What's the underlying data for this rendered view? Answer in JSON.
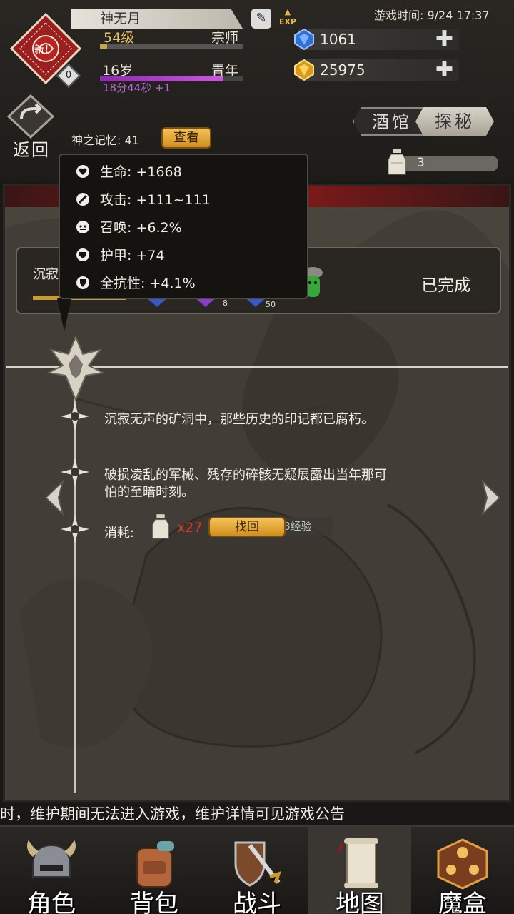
{
  "header": {
    "player_name": "神无月",
    "level_text": "54级",
    "title_text": "宗师",
    "level_progress": 0.05,
    "age_text": "16岁",
    "stage_text": "青年",
    "age_progress": 0.86,
    "timer_text": "18分44秒 +1",
    "avatar_badge": "新！",
    "level_badge": "0",
    "game_time": "游戏时间: 9/24 17:37",
    "exp_label": "EXP",
    "diamonds": "1061",
    "gold": "25975",
    "back_label": "返回",
    "memory_label": "神之记忆: 41",
    "view_button": "查看",
    "tab_tavern": "酒馆",
    "tab_explore": "探秘",
    "jar_count": "3"
  },
  "tooltip": {
    "stats": [
      {
        "icon": "heart-icon",
        "text": "生命: +1668"
      },
      {
        "icon": "sword-icon",
        "text": "攻击: +111~111"
      },
      {
        "icon": "summon-icon",
        "text": "召唤: +6.2%"
      },
      {
        "icon": "armor-icon",
        "text": "护甲: +74"
      },
      {
        "icon": "resist-icon",
        "text": "全抗性: +4.1%"
      }
    ]
  },
  "quest": {
    "name": "沉寂",
    "status": "已完成",
    "badge_values": [
      "8",
      "50"
    ]
  },
  "story": {
    "line1": "沉寂无声的矿洞中，那些历史的印记都已腐朽。",
    "line2a": "破损凌乱的军械、残存的碎骸无疑展露出当年那可",
    "line2b": "怕的至暗时刻。",
    "cost_label": "消耗:",
    "cost_amount": "x27",
    "find_button": "找回",
    "reward_text": "获得418经验"
  },
  "marquee": "时，维护期间无法进入游戏，维护详情可见游戏公告",
  "nav": [
    {
      "label": "角色",
      "icon": "helmet-icon"
    },
    {
      "label": "背包",
      "icon": "backpack-icon"
    },
    {
      "label": "战斗",
      "icon": "sword-shield-icon"
    },
    {
      "label": "地图",
      "icon": "scroll-map-icon"
    },
    {
      "label": "魔盒",
      "icon": "magic-box-icon"
    }
  ],
  "colors": {
    "gold_accent": "#e8c46a",
    "age_bar": "#b46fd0",
    "cost_red": "#d83a2a",
    "button_gold": "#f3c25a"
  }
}
